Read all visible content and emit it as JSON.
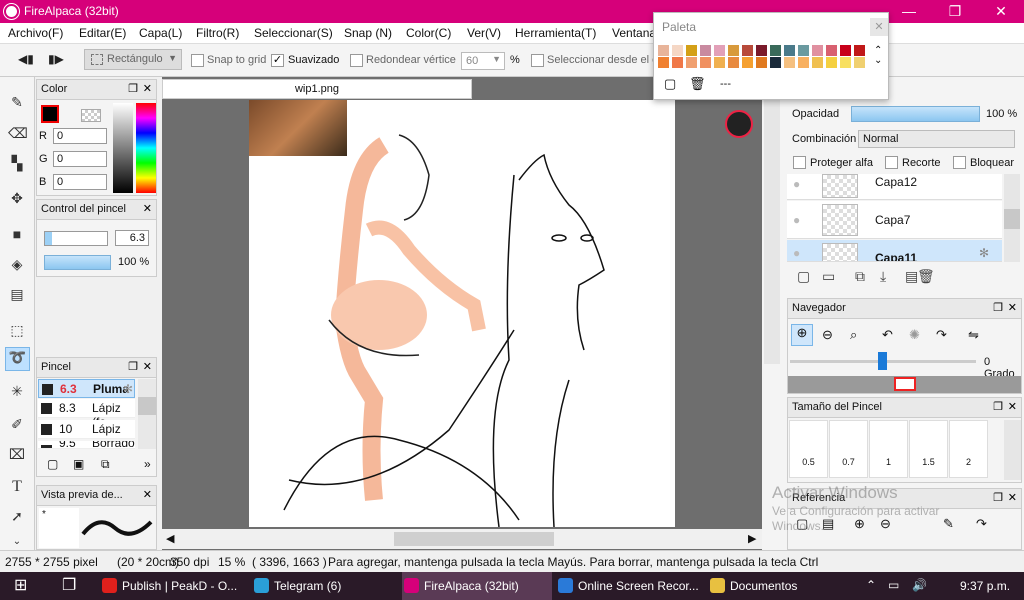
{
  "window": {
    "title": "FireAlpaca (32bit)",
    "min": "—",
    "max": "❐",
    "close": "✕"
  },
  "menu": [
    "Archivo(F)",
    "Editar(E)",
    "Capa(L)",
    "Filtro(R)",
    "Seleccionar(S)",
    "Snap (N)",
    "Color(C)",
    "Ver(V)",
    "Herramienta(T)",
    "Ventana"
  ],
  "toolbar": {
    "shape": "Rectángulo",
    "snap_grid": "Snap to grid",
    "antialias": "Suavizado",
    "round_corner": "Redondear vértice",
    "round_value": "60",
    "percent": "%",
    "select_from": "Seleccionar desde el c"
  },
  "color_panel": {
    "title": "Color",
    "r_label": "R",
    "g_label": "G",
    "b_label": "B",
    "r": "0",
    "g": "0",
    "b": "0"
  },
  "brush_control": {
    "title": "Control del pincel",
    "size": "6.3",
    "opacity": "100 %"
  },
  "brush_panel": {
    "title": "Pincel",
    "items": [
      {
        "size": "6.3",
        "name": "Pluma"
      },
      {
        "size": "8.3",
        "name": "Lápiz (fo"
      },
      {
        "size": "10",
        "name": "Lápiz"
      },
      {
        "size": "9.5",
        "name": "Borrado"
      }
    ],
    "more": "»"
  },
  "brush_preview": {
    "title": "Vista previa de...",
    "mark": "*"
  },
  "document": {
    "tab": "wip1.png"
  },
  "palette": {
    "title": "Paleta",
    "row1": [
      "#e8b49a",
      "#f5d7c5",
      "#d4a017",
      "#c98aa0",
      "#e2a0b8",
      "#d89a3c",
      "#b84a3a",
      "#7a1a2a",
      "#3a6a5a",
      "#4a7a8a",
      "#6a9aa0",
      "#e090a0",
      "#d86070",
      "#c8001a",
      "#c01818"
    ],
    "row2": [
      "#f08030",
      "#f07848",
      "#f0a070",
      "#f09060",
      "#f0b050",
      "#e88a40",
      "#f5a030",
      "#e07a20",
      "#1a2a3a",
      "#f5c080",
      "#f8b060",
      "#f0c050",
      "#f5d040",
      "#f8e060",
      "#f0d070"
    ],
    "dash": "---"
  },
  "layer_panel": {
    "opacity_label": "Opacidad",
    "opacity_value": "100 %",
    "blend_label": "Combinación",
    "blend_value": "Normal",
    "protect_alpha": "Proteger alfa",
    "clip": "Recorte",
    "lock": "Bloquear",
    "layers": [
      "Capa12",
      "Capa7",
      "Capa11"
    ]
  },
  "navigator": {
    "title": "Navegador",
    "angle": "0 Grado"
  },
  "brush_size_panel": {
    "title": "Tamaño del Pincel",
    "sizes": [
      "0.5",
      "0.7",
      "1",
      "1.5",
      "2"
    ]
  },
  "reference_panel": {
    "title": "Referencia"
  },
  "watermark": {
    "line1": "Activar Windows",
    "line2": "Ve a Configuración para activar",
    "line3": "Windows."
  },
  "status": {
    "pixels": "2755 * 2755 pixel",
    "cm": "(20 * 20cm)",
    "dpi": "350 dpi",
    "zoom": "15 %",
    "coords": "( 3396, 1663 )",
    "hint": "Para agregar, mantenga pulsada la tecla Mayús. Para borrar, mantenga pulsada la tecla Ctrl"
  },
  "taskbar": {
    "items": [
      {
        "label": "Publish | PeakD - O...",
        "color": "#e0201c"
      },
      {
        "label": "Telegram (6)",
        "color": "#2a9fd8"
      },
      {
        "label": "FireAlpaca (32bit)",
        "color": "#d6007a"
      },
      {
        "label": "Online Screen Recor...",
        "color": "#2a7ad8"
      },
      {
        "label": "Documentos",
        "color": "#e8c040"
      }
    ],
    "clock": "9:37 p.m."
  }
}
